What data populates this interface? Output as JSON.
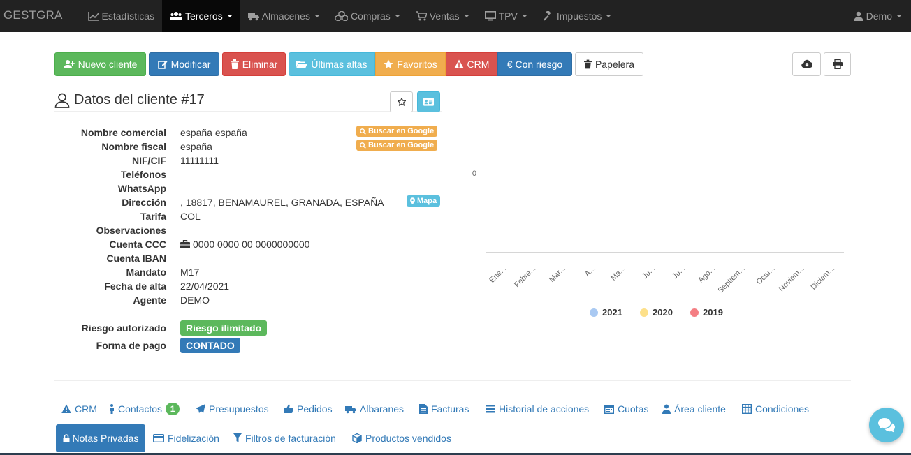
{
  "navbar": {
    "brand": "GESTGRA",
    "items": [
      {
        "label": "Estadísticas",
        "icon": "chart-line-icon",
        "dropdown": false,
        "active": false
      },
      {
        "label": "Terceros",
        "icon": "users-icon",
        "dropdown": true,
        "active": true
      },
      {
        "label": "Almacenes",
        "icon": "truck-icon",
        "dropdown": true,
        "active": false
      },
      {
        "label": "Compras",
        "icon": "cubes-icon",
        "dropdown": true,
        "active": false
      },
      {
        "label": "Ventas",
        "icon": "cart-icon",
        "dropdown": true,
        "active": false
      },
      {
        "label": "TPV",
        "icon": "monitor-icon",
        "dropdown": true,
        "active": false
      },
      {
        "label": "Impuestos",
        "icon": "gavel-icon",
        "dropdown": true,
        "active": false
      }
    ],
    "user": "Demo"
  },
  "toolbar": {
    "new_client": "Nuevo cliente",
    "modify": "Modificar",
    "delete": "Eliminar",
    "latest": "Últimas altas",
    "favorites": "Favoritos",
    "crm": "CRM",
    "risk": "€ Con riesgo",
    "trash": "Papelera"
  },
  "client": {
    "title": "Datos del cliente #17",
    "google_search": "Buscar en Google",
    "map": "Mapa",
    "fields": [
      {
        "label": "Nombre comercial",
        "value": "españa españa"
      },
      {
        "label": "Nombre fiscal",
        "value": "españa"
      },
      {
        "label": "NIF/CIF",
        "value": "11111111"
      },
      {
        "label": "Teléfonos",
        "value": ""
      },
      {
        "label": "WhatsApp",
        "value": ""
      },
      {
        "label": "Dirección",
        "value": ", 18817, BENAMAUREL, GRANADA, ESPAÑA"
      },
      {
        "label": "Tarifa",
        "value": "COL"
      },
      {
        "label": "Observaciones",
        "value": ""
      },
      {
        "label": "Cuenta CCC",
        "value": "0000 0000 00 0000000000"
      },
      {
        "label": "Cuenta IBAN",
        "value": ""
      },
      {
        "label": "Mandato",
        "value": "M17"
      },
      {
        "label": "Fecha de alta",
        "value": "22/04/2021"
      },
      {
        "label": "Agente",
        "value": "DEMO"
      }
    ],
    "risk_label": "Riesgo autorizado",
    "risk_value": "Riesgo ilimitado",
    "payment_label": "Forma de pago",
    "payment_value": "CONTADO"
  },
  "chart_data": {
    "type": "bar",
    "categories": [
      "Ene...",
      "Febre...",
      "Mar...",
      "A...",
      "Ma...",
      "Ju...",
      "Ju...",
      "Ago...",
      "Septiem...",
      "Octu...",
      "Noviem...",
      "Diciem..."
    ],
    "series": [
      {
        "name": "2021",
        "values": [
          0,
          0,
          0,
          0,
          0,
          0,
          0,
          0,
          0,
          0,
          0,
          0
        ],
        "color": "#a9c9f2"
      },
      {
        "name": "2020",
        "values": [
          0,
          0,
          0,
          0,
          0,
          0,
          0,
          0,
          0,
          0,
          0,
          0
        ],
        "color": "#fde08a"
      },
      {
        "name": "2019",
        "values": [
          0,
          0,
          0,
          0,
          0,
          0,
          0,
          0,
          0,
          0,
          0,
          0
        ],
        "color": "#f47e83"
      }
    ],
    "y_ticks": [
      "0"
    ],
    "legend_position": "bottom",
    "grid": true
  },
  "tabs": {
    "row1": [
      {
        "label": "CRM",
        "icon": "warning-icon"
      },
      {
        "label": "Contactos",
        "icon": "person-icon",
        "badge": "1"
      },
      {
        "label": "Presupuestos",
        "icon": "paper-plane-icon"
      },
      {
        "label": "Pedidos",
        "icon": "thumbs-up-icon"
      },
      {
        "label": "Albaranes",
        "icon": "truck-icon"
      },
      {
        "label": "Facturas",
        "icon": "file-icon"
      },
      {
        "label": "Historial de acciones",
        "icon": "list-icon"
      },
      {
        "label": "Cuotas",
        "icon": "calendar-icon"
      },
      {
        "label": "Área cliente",
        "icon": "user-icon"
      },
      {
        "label": "Condiciones",
        "icon": "table-icon"
      }
    ],
    "row2_active": {
      "label": "Notas Privadas",
      "icon": "lock-icon"
    },
    "row2": [
      {
        "label": "Fidelización",
        "icon": "credit-card-icon"
      },
      {
        "label": "Filtros de facturación",
        "icon": "filter-icon"
      },
      {
        "label": "Productos vendidos",
        "icon": "cube-icon"
      }
    ]
  }
}
